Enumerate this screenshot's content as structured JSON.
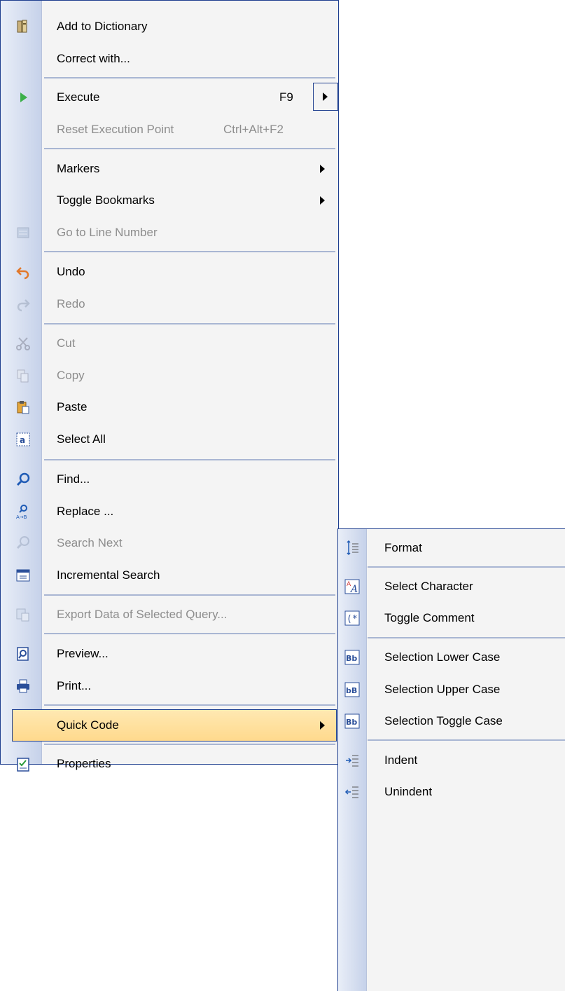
{
  "context_menu": {
    "items": [
      {
        "label": "Add to Dictionary",
        "icon": "dictionary-icon"
      },
      {
        "label": "Correct with...",
        "icon": ""
      },
      {
        "label": "Execute",
        "shortcut": "F9",
        "icon": "execute-play-icon",
        "has_split_submenu": true
      },
      {
        "label": "Reset Execution Point",
        "shortcut": "Ctrl+Alt+F2",
        "disabled": true
      },
      {
        "label": "Markers",
        "has_submenu": true
      },
      {
        "label": "Toggle Bookmarks",
        "has_submenu": true
      },
      {
        "label": "Go to Line Number",
        "icon": "go-to-line-icon",
        "disabled": true
      },
      {
        "label": "Undo",
        "icon": "undo-icon"
      },
      {
        "label": "Redo",
        "icon": "redo-icon",
        "disabled": true
      },
      {
        "label": "Cut",
        "icon": "cut-icon",
        "disabled": true
      },
      {
        "label": "Copy",
        "icon": "copy-icon",
        "disabled": true
      },
      {
        "label": "Paste",
        "icon": "paste-icon"
      },
      {
        "label": "Select All",
        "icon": "select-all-icon"
      },
      {
        "label": "Find...",
        "icon": "find-icon"
      },
      {
        "label": "Replace ...",
        "icon": "replace-icon"
      },
      {
        "label": "Search Next",
        "icon": "search-next-icon",
        "disabled": true
      },
      {
        "label": "Incremental Search",
        "icon": "incremental-search-icon"
      },
      {
        "label": "Export Data of Selected Query...",
        "icon": "export-data-icon",
        "disabled": true
      },
      {
        "label": "Preview...",
        "icon": "preview-icon"
      },
      {
        "label": "Print...",
        "icon": "print-icon"
      },
      {
        "label": "Quick Code",
        "has_submenu": true,
        "highlighted": true
      },
      {
        "label": "Properties",
        "icon": "properties-icon"
      }
    ]
  },
  "quick_code_submenu": {
    "items": [
      {
        "label": "Format",
        "icon": "format-icon"
      },
      {
        "label": "Select Character",
        "icon": "select-character-icon"
      },
      {
        "label": "Toggle Comment",
        "icon": "toggle-comment-icon",
        "icon_text": "(*"
      },
      {
        "label": "Selection Lower Case",
        "icon": "lower-case-icon",
        "icon_text": "Bb"
      },
      {
        "label": "Selection Upper Case",
        "icon": "upper-case-icon",
        "icon_text": "bB"
      },
      {
        "label": "Selection Toggle Case",
        "icon": "toggle-case-icon",
        "icon_text": "Bb"
      },
      {
        "label": "Indent",
        "icon": "indent-icon"
      },
      {
        "label": "Unindent",
        "icon": "unindent-icon"
      }
    ]
  },
  "colors": {
    "border": "#1f3f8f",
    "highlight": "#ffd98c",
    "disabled_text": "#8d8d8d",
    "menu_bg": "#f4f4f4"
  }
}
